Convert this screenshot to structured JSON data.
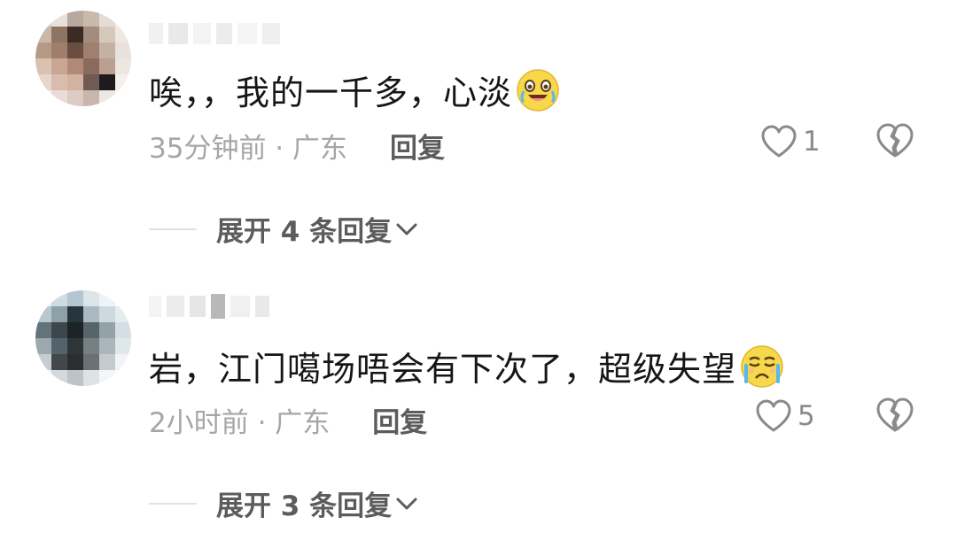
{
  "comments": [
    {
      "text": "唉，，我的一千多，心淡",
      "emoji": "crying-laughing-emoji",
      "time_location": "35分钟前 · 广东",
      "reply_label": "回复",
      "like_count": "1",
      "expand_label": "展开 4 条回复"
    },
    {
      "text": "岩，江门噶场唔会有下次了，超级失望",
      "emoji": "crying-emoji",
      "time_location": "2小时前 · 广东",
      "reply_label": "回复",
      "like_count": "5",
      "expand_label": "展开 3 条回复"
    }
  ],
  "colors": {
    "text": "#161616",
    "meta": "#a6a6a6",
    "action": "#5c5c5c",
    "divider": "#e2e2e2",
    "emoji_face": "#f6d84a"
  },
  "icons": [
    "heart-outline-icon",
    "broken-heart-icon",
    "chevron-down-icon"
  ]
}
